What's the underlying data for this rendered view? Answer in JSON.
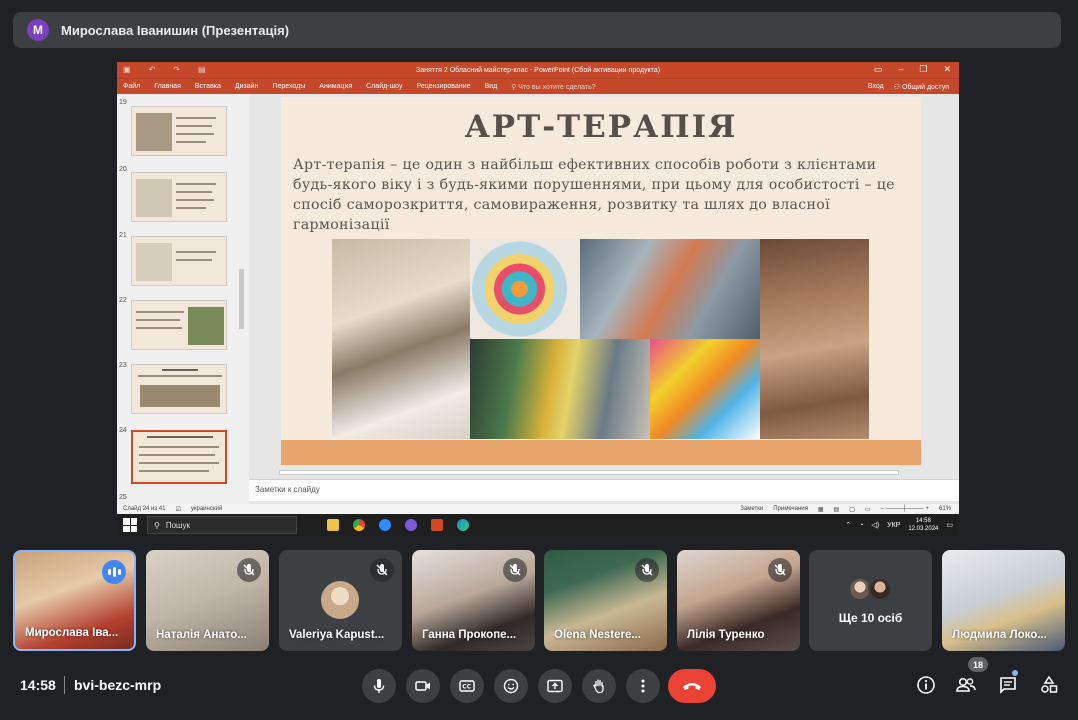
{
  "presenter": {
    "avatar_letter": "M",
    "title": "Мирослава Іванишин (Презентація)"
  },
  "powerpoint": {
    "window_title": "Заняття 2 Обласний майстер-клас - PowerPoint (Сбой активации продукта)",
    "ribbon_tabs": [
      "Файл",
      "Главная",
      "Вставка",
      "Дизайн",
      "Переходы",
      "Анимация",
      "Слайд-шоу",
      "Рецензирование",
      "Вид"
    ],
    "tell_me": "Что вы хотите сделать?",
    "sign_in": "Вход",
    "share": "Общий доступ",
    "thumbnails": [
      {
        "num": "19"
      },
      {
        "num": "20"
      },
      {
        "num": "21"
      },
      {
        "num": "22"
      },
      {
        "num": "23"
      },
      {
        "num": "24"
      },
      {
        "num": "25"
      }
    ],
    "slide": {
      "title": "АРТ-ТЕРАПІЯ",
      "text": "Арт-терапія – це один з найбільш ефективних способів роботи з клієнтами будь-якого віку і з будь-якими порушеннями, при цьому для особистості – це спосіб саморозкриття, самовираження, розвитку та шлях до власної гармонізації"
    },
    "notes_placeholder": "Заметки к слайду",
    "status_left": "Слайд 24 из 41",
    "status_lang": "украинский",
    "status_notes": "Заметки",
    "status_comments": "Примечания",
    "zoom": "61%"
  },
  "taskbar": {
    "search": "Пошук",
    "lang": "УКР",
    "time": "14:58",
    "date": "12.03.2024"
  },
  "participants": [
    {
      "name": "Мирослава Іва...",
      "state": "speaking"
    },
    {
      "name": "Наталія Анато...",
      "state": "muted"
    },
    {
      "name": "Valeriya Kapust...",
      "state": "muted"
    },
    {
      "name": "Ганна Прокопе...",
      "state": "muted"
    },
    {
      "name": "Olena Nestere...",
      "state": "muted"
    },
    {
      "name": "Лілія Туренко",
      "state": "muted"
    },
    {
      "name": "Ще 10 осіб",
      "state": "group"
    },
    {
      "name": "Людмила Локо...",
      "state": "video"
    }
  ],
  "bottom_bar": {
    "time": "14:58",
    "meeting_code": "bvi-bezc-mrp",
    "participants_count": "18"
  },
  "colors": {
    "accent": "#8ab4f8",
    "end_call": "#ea4335",
    "ppt_orange": "#c5482a",
    "speaking": "#4285f4"
  }
}
